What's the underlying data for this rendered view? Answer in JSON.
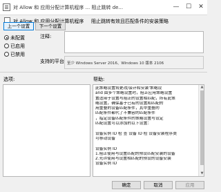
{
  "window": {
    "title": "对 Allow 和 应用分配计算机程序 ... 阻止跳转 de...",
    "minimize": "—",
    "maximize": "☐",
    "close": "✕"
  },
  "header": {
    "title_left": "对 Allow 和 应用分配计算机程序",
    "title_right": "阻止跳转有效且匹配条件的安装策略"
  },
  "nav": {
    "prev": "上一个设置",
    "next": "下一个设置"
  },
  "state": {
    "options": [
      {
        "label": "未配置",
        "selected": true
      },
      {
        "label": "已启用",
        "selected": false
      },
      {
        "label": "已禁用",
        "selected": false
      }
    ]
  },
  "comment": {
    "label": "注释:",
    "value": ""
  },
  "supported": {
    "label": "支持的平台:",
    "value": "至少 Windows Server 2016、Windows 10 版本 2106"
  },
  "sections": {
    "options_label": "选项:",
    "help_label": "帮助:"
  },
  "help_lines": [
    "此策略设置将更改/会计和安装'策略设",
    "and 由多个策略设置时，阻止应用策略设置",
    "置适用于设置与阻止的设置相匹配，所有此策",
    "略设置，确保基于已有的设置和匹配的",
    "用重叠的设备匹配条件，其中重叠的",
    "匹配条件都代了不兼容的匹配条件",
    "，指定设备匹配条件的策略设置与设定",
    "匹配设置可以添加的以下设置：",
    "",
    "设备实例 ID 检  查   设备 ID 检      设备安装程序类",
    "可移动设备",
    "",
    "设备实例 ID",
    "1.阻止使用与设置匹配的预设匹配安装的设备",
    "2.允许使用与设置相匹配的预设的设备安装",
    "设备实例 ID"
  ],
  "footer": {
    "ok": "确定",
    "cancel": "取消",
    "apply": "应用"
  }
}
